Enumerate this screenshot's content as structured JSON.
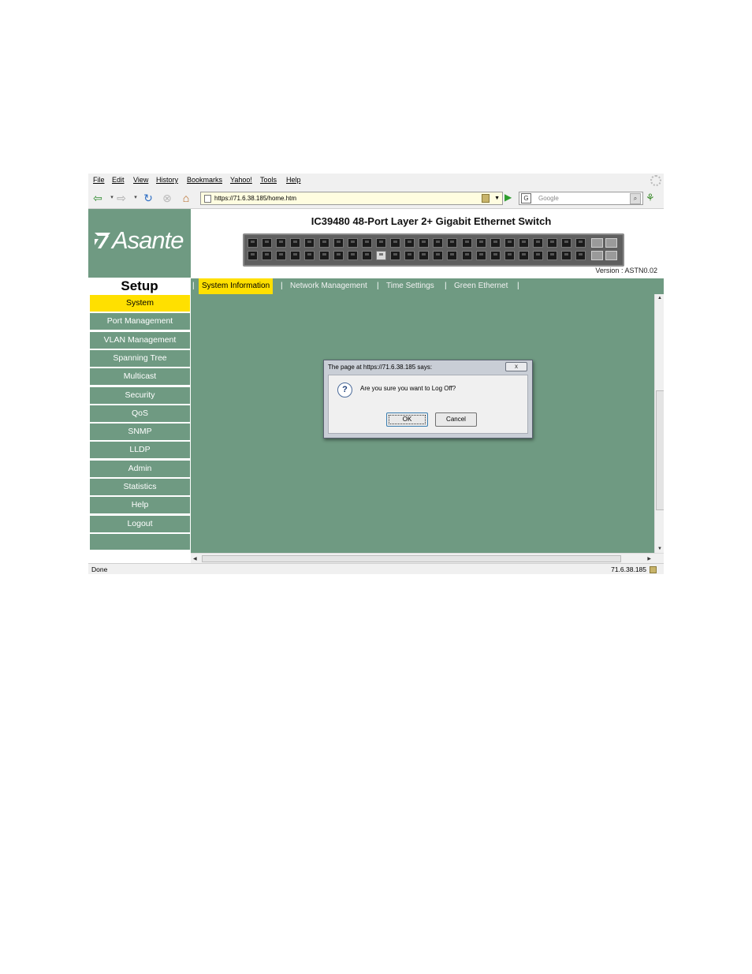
{
  "browser": {
    "menu": [
      "File",
      "Edit",
      "View",
      "History",
      "Bookmarks",
      "Yahoo!",
      "Tools",
      "Help"
    ],
    "url": "https://71.6.38.185/home.htm",
    "search_placeholder": "Google",
    "search_engine_glyph": "G",
    "icons": {
      "back": "back-arrow-icon",
      "forward": "forward-arrow-icon",
      "reload": "reload-icon",
      "stop": "stop-icon",
      "home": "home-icon",
      "go": "go-arrow-icon",
      "search": "magnifier-icon",
      "addon": "addon-icon",
      "lock": "lock-icon"
    }
  },
  "header": {
    "brand": "Asante",
    "title": "IC39480 48-Port Layer 2+ Gigabit Ethernet Switch",
    "version_label": "Version :",
    "version_value": "ASTN0.02"
  },
  "switch_panel": {
    "ports_total": 48,
    "selected_port_index": 9,
    "sfp_slots": 4
  },
  "sidebar": {
    "title": "Setup",
    "items": [
      {
        "label": "System",
        "active": true
      },
      {
        "label": "Port Management",
        "active": false
      },
      {
        "label": "VLAN Management",
        "active": false
      },
      {
        "label": "Spanning Tree",
        "active": false
      },
      {
        "label": "Multicast",
        "active": false
      },
      {
        "label": "Security",
        "active": false
      },
      {
        "label": "QoS",
        "active": false
      },
      {
        "label": "SNMP",
        "active": false
      },
      {
        "label": "LLDP",
        "active": false
      },
      {
        "label": "Admin",
        "active": false
      },
      {
        "label": "Statistics",
        "active": false
      },
      {
        "label": "Help",
        "active": false
      },
      {
        "label": "Logout",
        "active": false
      }
    ]
  },
  "tabs": [
    {
      "label": "System Information",
      "active": true
    },
    {
      "label": "Network Management",
      "active": false
    },
    {
      "label": "Time Settings",
      "active": false
    },
    {
      "label": "Green Ethernet",
      "active": false
    }
  ],
  "dialog": {
    "title": "The page at https://71.6.38.185 says:",
    "message": "Are you sure you want to Log Off?",
    "icon": "question-icon",
    "ok_label": "OK",
    "cancel_label": "Cancel",
    "close_glyph": "x"
  },
  "status": {
    "left": "Done",
    "right": "71.6.38.185"
  },
  "colors": {
    "brand_green": "#6f9a82",
    "active_yellow": "#ffe000"
  }
}
